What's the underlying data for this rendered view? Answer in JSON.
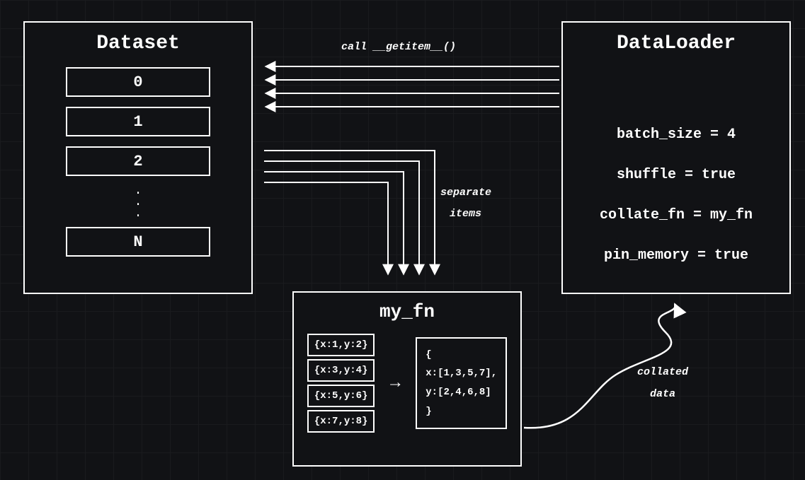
{
  "dataset": {
    "title": "Dataset",
    "items": [
      "0",
      "1",
      "2",
      "N"
    ],
    "dots": "."
  },
  "dataloader": {
    "title": "DataLoader",
    "config": [
      "batch_size = 4",
      "shuffle = true",
      "collate_fn = my_fn",
      "pin_memory = true"
    ]
  },
  "myfn": {
    "title": "my_fn",
    "inputs": [
      "{x:1,y:2}",
      "{x:3,y:4}",
      "{x:5,y:6}",
      "{x:7,y:8}"
    ],
    "output_lines": [
      "{",
      "  x:[1,3,5,7],",
      "  y:[2,4,6,8]",
      "}"
    ],
    "arrow": "→"
  },
  "labels": {
    "call_getitem": "call __getitem__()",
    "separate_items_1": "separate",
    "separate_items_2": "items",
    "collated_1": "collated",
    "collated_2": "data"
  }
}
